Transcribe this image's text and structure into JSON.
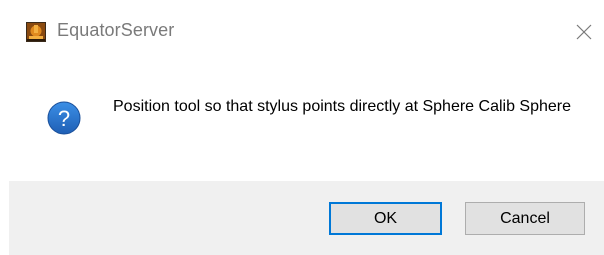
{
  "window": {
    "title": "EquatorServer",
    "app_icon": "equator-app-icon",
    "close_icon": "close-icon"
  },
  "message": {
    "icon": "question-icon",
    "text": "Position tool so that stylus points directly at Sphere Calib Sphere"
  },
  "buttons": {
    "ok_label": "OK",
    "cancel_label": "Cancel"
  },
  "colors": {
    "accent": "#0078d7",
    "footer_bg": "#f0f0f0"
  }
}
